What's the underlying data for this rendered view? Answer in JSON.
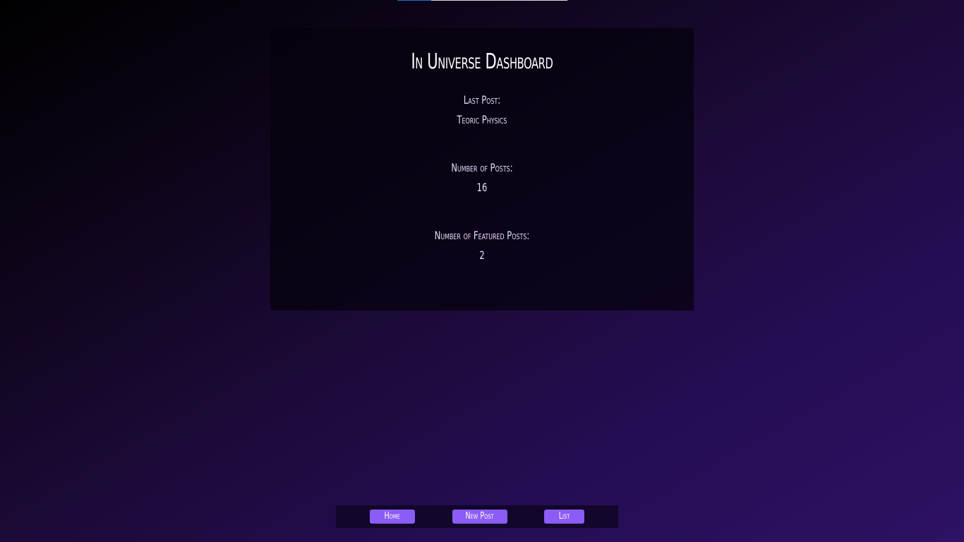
{
  "progress": {
    "fraction": 0.2,
    "fill_color": "#1f6fd6",
    "track_color": "#d9d9d9"
  },
  "dashboard": {
    "title": "In Universe Dashboard",
    "stats": [
      {
        "label": "Last Post:",
        "value": "Teoric Physics"
      },
      {
        "label": "Number of Posts:",
        "value": "16"
      },
      {
        "label": "Number of Featured Posts:",
        "value": "2"
      }
    ]
  },
  "nav": {
    "home_label": "Home",
    "new_post_label": "New Post",
    "list_label": "List"
  },
  "colors": {
    "accent": "#8b5cf6",
    "background_end": "#2e1164"
  }
}
